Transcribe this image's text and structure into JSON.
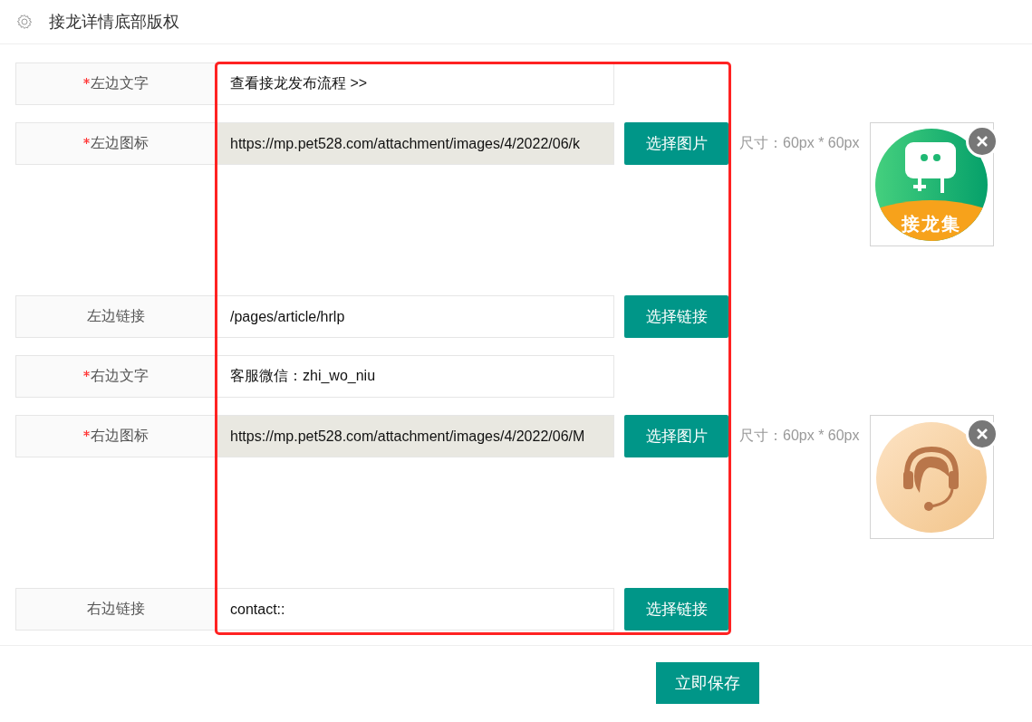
{
  "header": {
    "title": "接龙详情底部版权"
  },
  "fields": [
    {
      "kind": "text",
      "label": "左边文字",
      "required": true,
      "value": "查看接龙发布流程 >>"
    },
    {
      "kind": "image",
      "label": "左边图标",
      "required": true,
      "value": "https://mp.pet528.com/attachment/images/4/2022/06/k",
      "button": "选择图片",
      "note": "尺寸：60px * 60px",
      "preview": {
        "kind": "logo",
        "caption": "接龙集"
      }
    },
    {
      "kind": "link",
      "label": "左边链接",
      "required": false,
      "value": "/pages/article/hrlp",
      "button": "选择链接"
    },
    {
      "kind": "text",
      "label": "右边文字",
      "required": true,
      "value": "客服微信：zhi_wo_niu"
    },
    {
      "kind": "image",
      "label": "右边图标",
      "required": true,
      "value": "https://mp.pet528.com/attachment/images/4/2022/06/M",
      "button": "选择图片",
      "note": "尺寸：60px * 60px",
      "preview": {
        "kind": "headset"
      }
    },
    {
      "kind": "link",
      "label": "右边链接",
      "required": false,
      "value": "contact::",
      "button": "选择链接"
    }
  ],
  "save_button": "立即保存"
}
